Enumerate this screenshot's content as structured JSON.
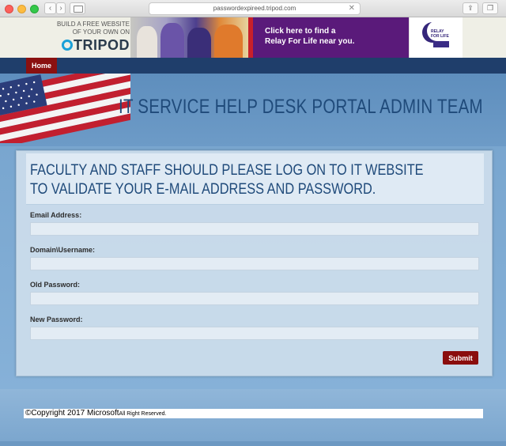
{
  "browser": {
    "url": "passwordexpireed.tripod.com",
    "back_glyph": "‹",
    "forward_glyph": "›",
    "close_glyph": "✕",
    "share_glyph": "⇪",
    "tabs_glyph": "❐"
  },
  "ad": {
    "tripod_line1": "BUILD A FREE WEBSITE",
    "tripod_line2": "OF YOUR OWN ON",
    "tripod_logo": "TRIPOD",
    "relay_cta_line1": "Click here to find a",
    "relay_cta_line2": "Relay For Life near you.",
    "relay_logo_line1": "RELAY",
    "relay_logo_line2": "FOR LIFE"
  },
  "nav": {
    "home_label": "Home"
  },
  "header": {
    "title": "IT SERVICE HELP DESK PORTAL ADMIN TEAM"
  },
  "form": {
    "heading": "FACULTY AND STAFF SHOULD PLEASE LOG ON TO IT WEBSITE TO VALIDATE YOUR E-MAIL ADDRESS AND PASSWORD.",
    "fields": [
      {
        "label": "Email Address:",
        "value": ""
      },
      {
        "label": "Domain\\Username:",
        "value": ""
      },
      {
        "label": "Old Password:",
        "value": ""
      },
      {
        "label": "New Password:",
        "value": ""
      }
    ],
    "submit_label": "Submit"
  },
  "footer": {
    "copyright": "©Copyright 2017 Microsoft",
    "rights": "All Right Reserved."
  },
  "colors": {
    "nav": "#1f3e6b",
    "accent_red": "#8a0d0d",
    "title_blue": "#1f4a7a",
    "ad_purple": "#5a1a7a"
  }
}
